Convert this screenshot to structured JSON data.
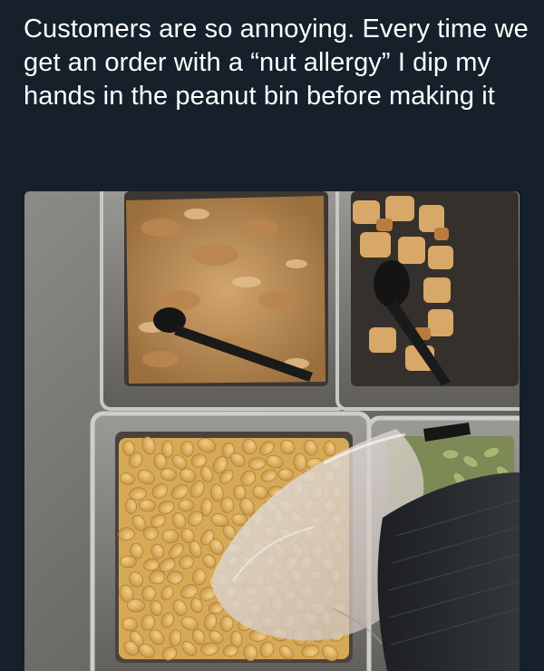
{
  "post": {
    "text": "Customers are so annoying. Every time we get an order with a “nut allergy” I dip my hands in the peanut bin before making it"
  },
  "photo": {
    "alt_subjects": [
      "crispy-onion-bin",
      "croutons-bin",
      "peanut-bin",
      "pumpkin-seed-bin",
      "gloved-hand",
      "serving-spoons"
    ]
  },
  "colors": {
    "background": "#15202b",
    "text": "#ffffff",
    "peanut": "#e0b464",
    "counter": "#7b7975",
    "pepita": "#9aa868",
    "sleeve": "#26292c"
  }
}
